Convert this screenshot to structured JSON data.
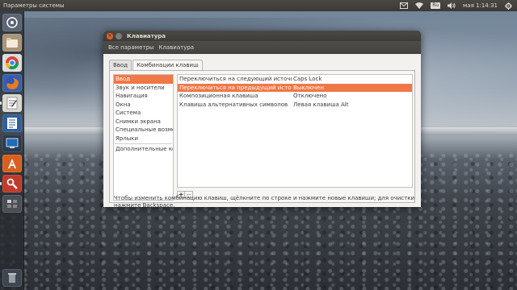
{
  "top_panel": {
    "title": "Параметры системы",
    "indicators": [
      "mail-icon",
      "wifi-icon",
      "keyboard-layout",
      "volume-icon"
    ],
    "keyboard_layout": "Ru",
    "clock": "мая 1:14:31"
  },
  "launcher": {
    "items": [
      "dash-icon",
      "files-icon",
      "chrome-icon",
      "firefox-icon",
      "text-editor-icon",
      "writer-icon",
      "screenshot-icon",
      "software-center-icon",
      "system-settings-icon",
      "workspaces-icon"
    ]
  },
  "window": {
    "title": "Клавиатура",
    "toolbar": {
      "all_settings": "Все параметры",
      "current": "Клавиатура"
    },
    "tabs": [
      {
        "label": "Ввод",
        "active": false
      },
      {
        "label": "Комбинации клавиш",
        "active": true
      }
    ],
    "categories": [
      {
        "label": "Ввод",
        "selected": true
      },
      {
        "label": "Звук и носители",
        "selected": false
      },
      {
        "label": "Навигация",
        "selected": false
      },
      {
        "label": "Окна",
        "selected": false
      },
      {
        "label": "Система",
        "selected": false
      },
      {
        "label": "Снимки экрана",
        "selected": false
      },
      {
        "label": "Специальные возмо...",
        "selected": false
      },
      {
        "label": "Ярлыки",
        "selected": false
      },
      {
        "label": "Дополнительные ко...",
        "selected": false
      }
    ],
    "shortcuts": [
      {
        "name": "Переключиться на следующий источник",
        "key": "Caps Lock",
        "selected": false
      },
      {
        "name": "Переключиться на предыдущий источник",
        "key": "Выключен",
        "selected": true
      },
      {
        "name": "Композиционная клавиша",
        "key": "Отключено",
        "selected": false
      },
      {
        "name": "Клавиша альтернативных символов",
        "key": "Левая клавиша Alt",
        "selected": false
      }
    ],
    "add_label": "+",
    "remove_label": "−",
    "hint": "Чтобы изменить комбинацию клавиш, щёлкните по строке и нажмите новые клавиши; для очистки нажмите Backspace.",
    "colors": {
      "selection": "#f07746",
      "close_button": "#e45e2b"
    }
  }
}
